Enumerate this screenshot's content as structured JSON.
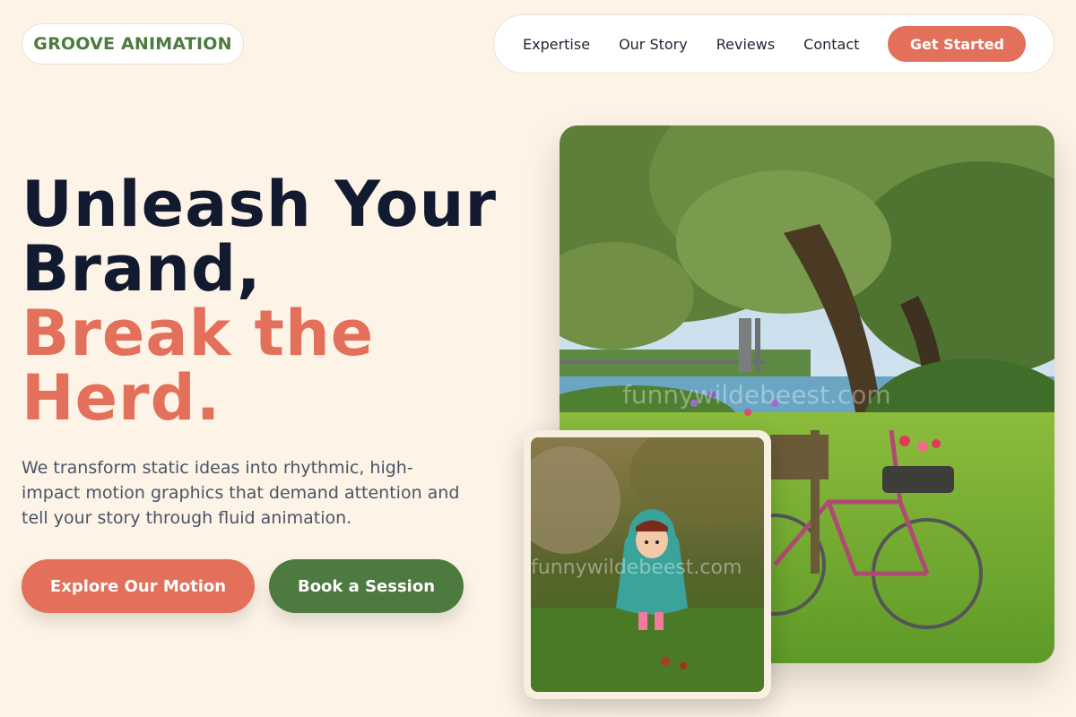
{
  "brand": {
    "name": "GROOVE ANIMATION",
    "color": "#4c7a3f"
  },
  "nav": {
    "items": [
      "Expertise",
      "Our Story",
      "Reviews",
      "Contact"
    ],
    "cta": "Get Started"
  },
  "hero": {
    "headline_line1": "Unleash Your",
    "headline_line2": "Brand,",
    "headline_accent1": "Break the",
    "headline_accent2": "Herd.",
    "description": "We transform static ideas into rhythmic, high-impact motion graphics that demand attention and tell your story through fluid animation.",
    "primary_button": "Explore Our Motion",
    "secondary_button": "Book a Session"
  },
  "images": {
    "main": {
      "watermark": "funnywildebeest.com"
    },
    "small": {
      "watermark": "funnywildebeest.com"
    }
  },
  "colors": {
    "accent": "#e2705a",
    "green": "#4c7a3f",
    "background": "#fdf3e6",
    "heading": "#121a30"
  }
}
